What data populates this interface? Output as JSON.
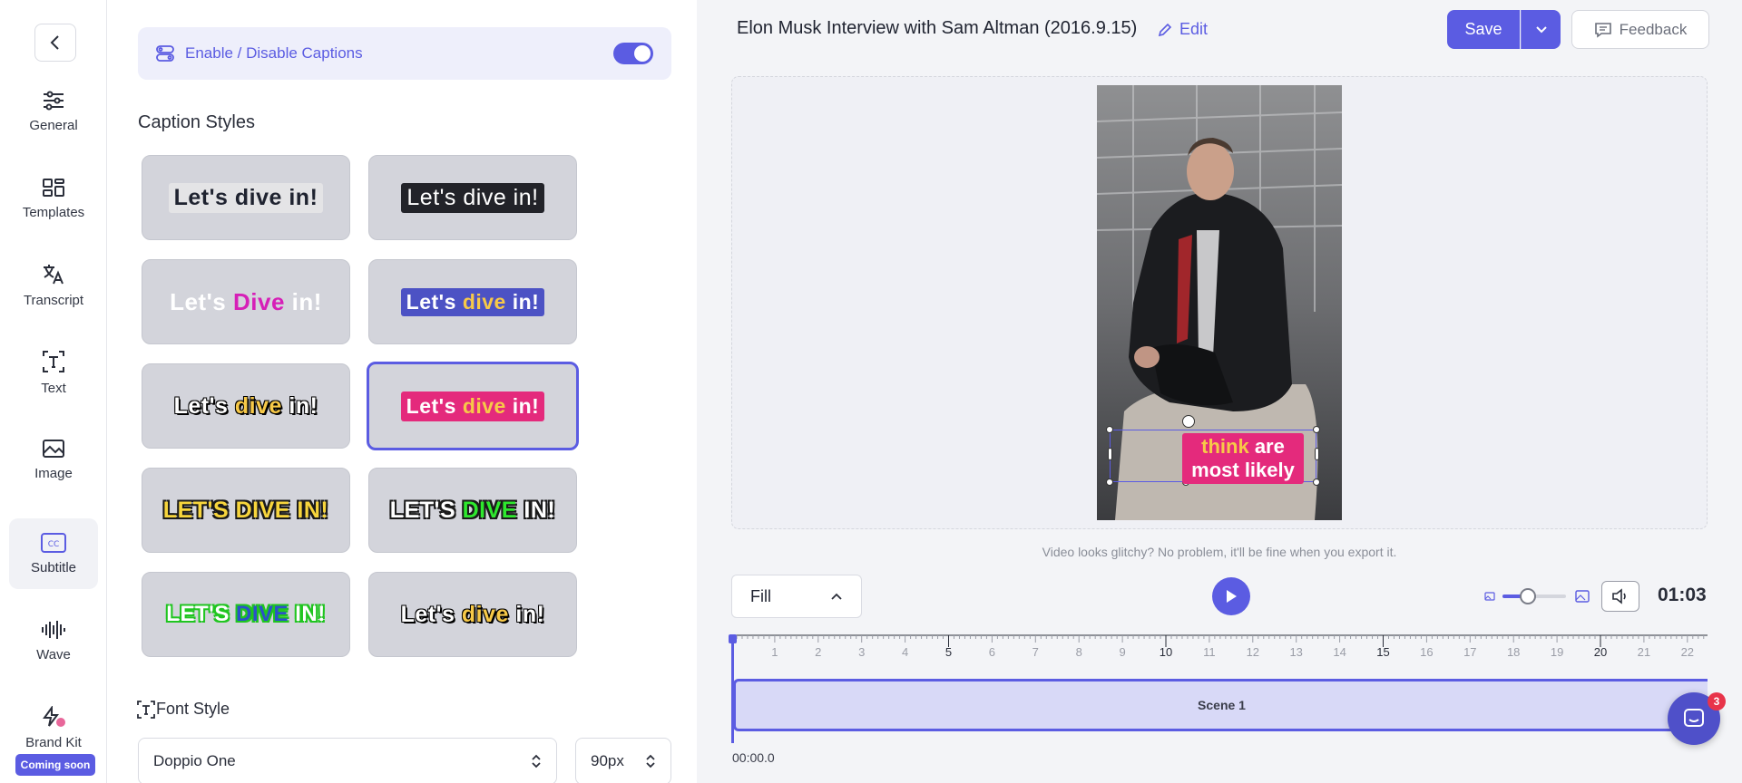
{
  "rail": {
    "items": [
      {
        "label": "General",
        "icon": "sliders-icon"
      },
      {
        "label": "Templates",
        "icon": "templates-icon"
      },
      {
        "label": "Transcript",
        "icon": "translate-icon"
      },
      {
        "label": "Text",
        "icon": "text-icon"
      },
      {
        "label": "Image",
        "icon": "image-icon"
      },
      {
        "label": "Subtitle",
        "icon": "cc-icon",
        "active": true
      },
      {
        "label": "Wave",
        "icon": "waveform-icon"
      },
      {
        "label": "Brand Kit",
        "icon": "brand-kit-icon"
      }
    ],
    "coming_soon": "Coming soon"
  },
  "panel": {
    "enable_label": "Enable / Disable Captions",
    "captions_enabled": true,
    "section_title": "Caption Styles",
    "styles": [
      {
        "text": "Let's  dive  in!"
      },
      {
        "text": "Let's  dive  in!"
      },
      {
        "w1": "Let's",
        "w2": "Dive",
        "w3": "in!"
      },
      {
        "w1": "Let's",
        "w2": "dive",
        "w3": "in!"
      },
      {
        "w1": "Let's",
        "w2": "dive",
        "w3": "in!"
      },
      {
        "w1": "Let's",
        "w2": "dive",
        "w3": "in!",
        "selected": true
      },
      {
        "text": "LET'S  DIVE  IN!"
      },
      {
        "w1": "LET'S",
        "w2": "DIVE",
        "w3": "IN!"
      },
      {
        "w1": "LET'S",
        "w2": "DIVE",
        "w3": "IN!"
      },
      {
        "w1": "Let's",
        "w2": "dive",
        "w3": "in!"
      }
    ],
    "font_style_label": "Font Style",
    "font_family": "Doppio One",
    "font_size": "90px"
  },
  "editor": {
    "title": "Elon Musk Interview with Sam Altman (2016.9.15)",
    "edit_label": "Edit",
    "save_label": "Save",
    "feedback_label": "Feedback",
    "caption_preview": {
      "w1": "think",
      "w2": "are",
      "line2": "most likely"
    },
    "glitch_note": "Video looks glitchy? No problem, it'll be fine when you export it.",
    "fit_mode": "Fill",
    "zoom_level": 0.4,
    "duration": "01:03",
    "ruler_ticks": [
      "1",
      "2",
      "3",
      "4",
      "5",
      "6",
      "7",
      "8",
      "9",
      "10",
      "11",
      "12",
      "13",
      "14",
      "15",
      "16",
      "17",
      "18",
      "19",
      "20",
      "21",
      "22"
    ],
    "scene_label": "Scene 1",
    "start_time": "00:00.0",
    "chat_badge": "3"
  },
  "colors": {
    "accent": "#5b5ce2",
    "caption_pink": "#e42a7c",
    "caption_yellow": "#f7c948"
  }
}
